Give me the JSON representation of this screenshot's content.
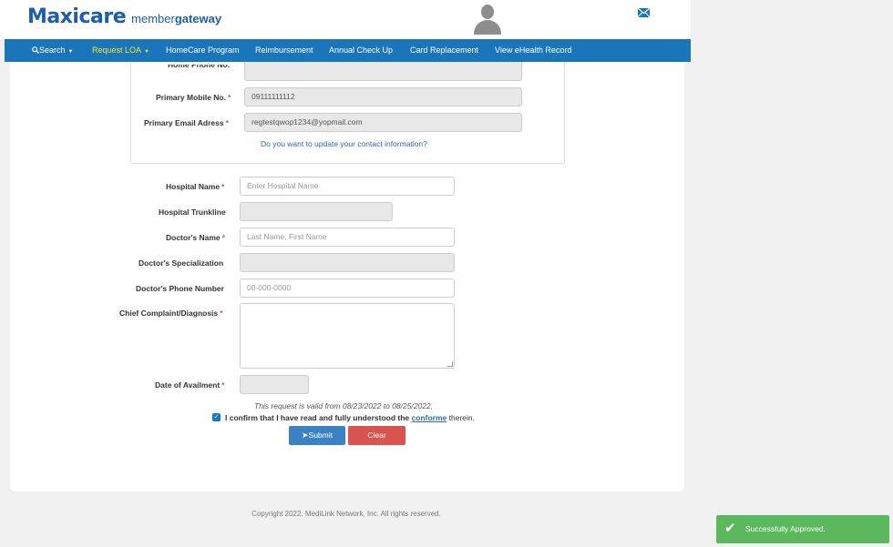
{
  "header": {
    "logo_main": "Maxicare",
    "logo_sub_light": "member",
    "logo_sub_bold": "gateway"
  },
  "nav": {
    "search": "Search",
    "request_loa": "Request LOA",
    "homecare": "HomeCare Program",
    "reimbursement": "Reimbursement",
    "annual_checkup": "Annual Check Up",
    "card_replacement": "Card Replacement",
    "ehealth": "View eHealth Record"
  },
  "contact": {
    "home_phone_label": "Home Phone No.",
    "mobile_label": "Primary Mobile No.",
    "mobile_value": "09111111112",
    "email_label": "Primary Email Adress",
    "email_value": "regtestqwop1234@yopmail.com",
    "update_link": "Do you want to update your contact information?"
  },
  "form": {
    "hospital_name_label": "Hospital Name",
    "hospital_name_placeholder": "Enter Hospital Name",
    "hospital_trunkline_label": "Hospital Trunkline",
    "doctor_name_label": "Doctor's Name",
    "doctor_name_placeholder": "Last Name, First Name",
    "doctor_spec_label": "Doctor's Specialization",
    "doctor_phone_label": "Doctor's Phone Number",
    "doctor_phone_placeholder": "00-000-0000",
    "complaint_label": "Chief Complaint/Diagnosis",
    "availment_label": "Date of Availment",
    "required_mark": "*"
  },
  "validity": {
    "text": "This request is valid from 08/23/2022 to 08/25/2022."
  },
  "confirm": {
    "prefix": "I confirm that I have read and fully understood the",
    "link": "conforme",
    "suffix": "therein."
  },
  "buttons": {
    "submit": "Submit",
    "clear": "Clear"
  },
  "footer": {
    "copyright": "Copyright 2022. MediLink Network, Inc. All rights reserved."
  },
  "toast": {
    "message": "Successfully Approved."
  },
  "colors": {
    "brand": "#1b5fa8",
    "nav_bg": "#1a75bb",
    "nav_active": "#f2e830",
    "submit": "#3a82c4",
    "clear": "#d9534f",
    "toast": "#5cb85c"
  }
}
